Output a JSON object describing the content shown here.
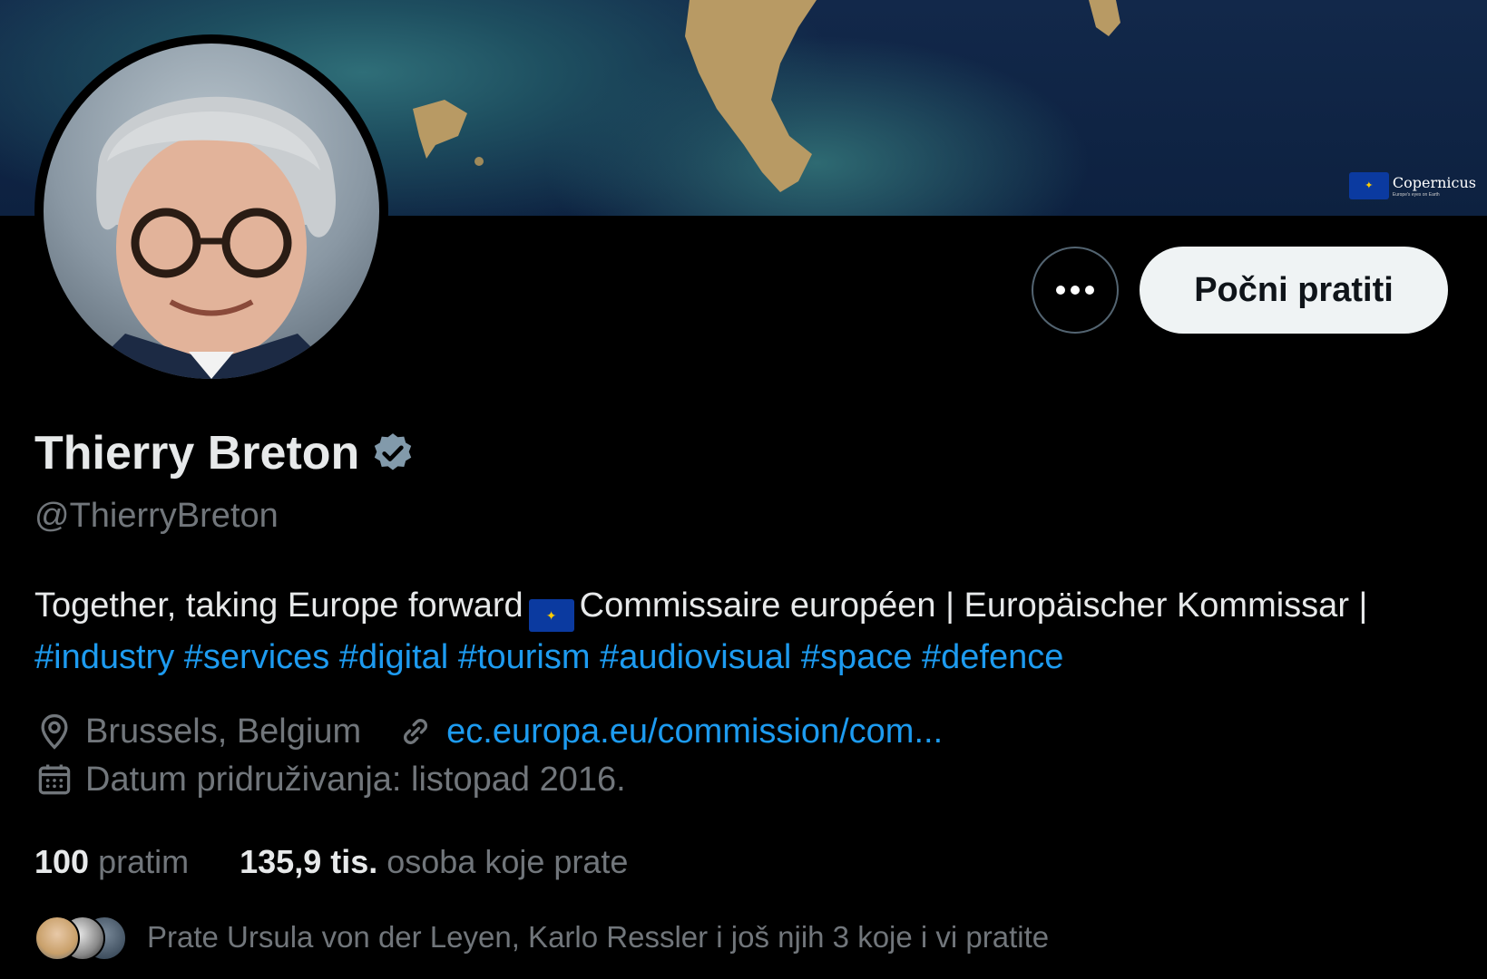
{
  "banner": {
    "logo_text": "Copernicus",
    "logo_tagline": "Europe's eyes on Earth"
  },
  "profile": {
    "name": "Thierry Breton",
    "verified_icon": "verified-badge-icon",
    "handle": "@ThierryBreton",
    "bio": {
      "text_1": "Together, taking Europe forward",
      "text_2": "Commissaire européen | Europäischer Kommissar |",
      "hashtags": [
        "#industry",
        "#services",
        "#digital",
        "#tourism",
        "#audiovisual",
        "#space",
        "#defence"
      ]
    },
    "location": "Brussels, Belgium",
    "website": "ec.europa.eu/commission/com...",
    "joined": "Datum pridruživanja: listopad 2016."
  },
  "actions": {
    "more_icon": "more-icon",
    "follow_label": "Počni pratiti"
  },
  "stats": {
    "following_count": "100",
    "following_label": "pratim",
    "followers_count": "135,9 tis.",
    "followers_label": "osoba koje prate"
  },
  "known_followers": "Prate Ursula von der Leyen, Karlo Ressler i još njih 3 koje i vi pratite",
  "colors": {
    "background": "#000000",
    "text": "#e7e9ea",
    "muted": "#71767b",
    "link": "#1d9bf0",
    "follow_button": "#eff3f4",
    "verified_badge": "#829aab"
  }
}
